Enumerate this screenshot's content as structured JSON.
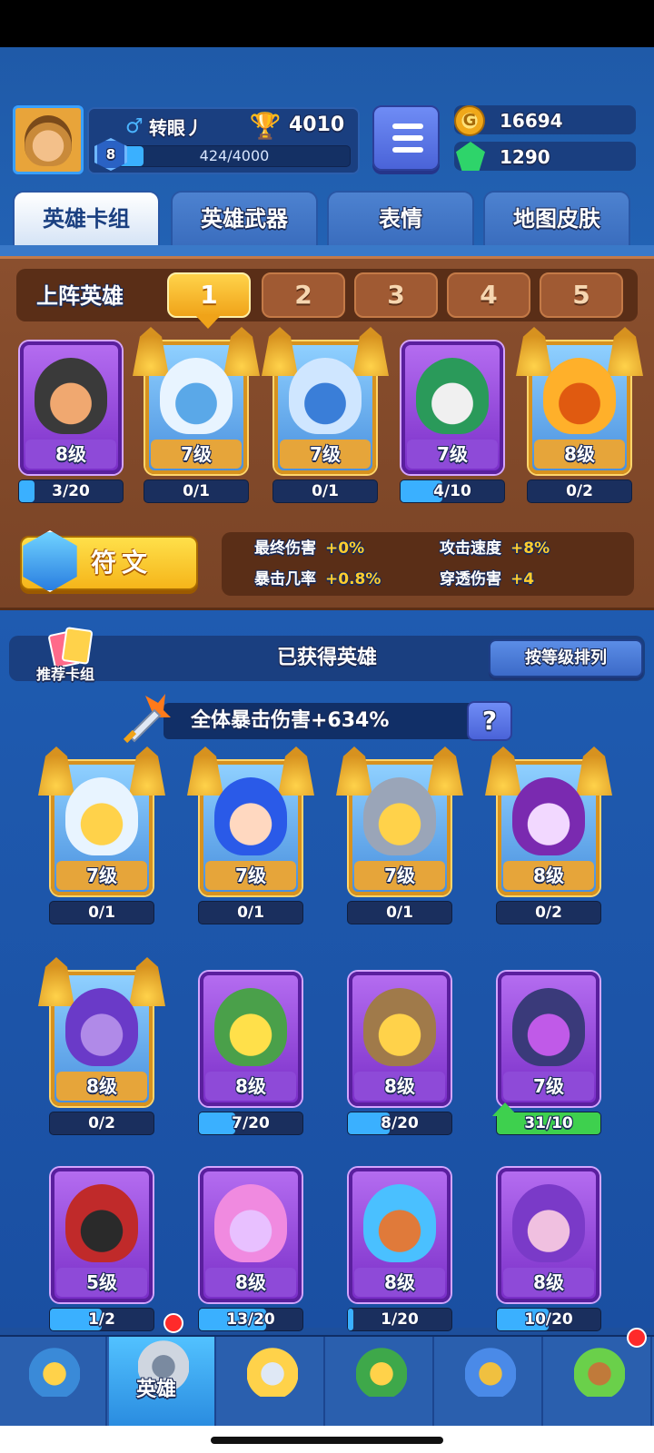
{
  "player": {
    "name": "转眼丿",
    "gender_symbol": "♂",
    "trophies": "4010",
    "level": "8",
    "xp_text": "424/4000",
    "xp_progress": 0.106
  },
  "currency": {
    "gold": "16694",
    "gold_symbol": "G",
    "gems": "1290"
  },
  "tabs": [
    {
      "label": "英雄卡组",
      "active": true
    },
    {
      "label": "英雄武器",
      "active": false
    },
    {
      "label": "表情",
      "active": false
    },
    {
      "label": "地图皮肤",
      "active": false
    }
  ],
  "lineup": {
    "title": "上阵英雄",
    "slots": [
      "1",
      "2",
      "3",
      "4",
      "5"
    ],
    "active_slot": 0,
    "heroes": [
      {
        "level": "8级",
        "progress": "3/20",
        "ratio": 0.15,
        "rarity": "purple",
        "art": "masked-thief"
      },
      {
        "level": "7级",
        "progress": "0/1",
        "ratio": 0.0,
        "rarity": "gold",
        "art": "yeti"
      },
      {
        "level": "7级",
        "progress": "0/1",
        "ratio": 0.0,
        "rarity": "gold",
        "art": "ice-king"
      },
      {
        "level": "7级",
        "progress": "4/10",
        "ratio": 0.4,
        "rarity": "purple",
        "art": "green-hat-ghost"
      },
      {
        "level": "8级",
        "progress": "0/2",
        "ratio": 0.0,
        "rarity": "gold",
        "art": "pumpkin"
      }
    ]
  },
  "rune": {
    "label": "符文",
    "stats": [
      {
        "name": "最终伤害",
        "bonus": "+0%"
      },
      {
        "name": "攻击速度",
        "bonus": "+8%"
      },
      {
        "name": "暴击几率",
        "bonus": "+0.8%"
      },
      {
        "name": "穿透伤害",
        "bonus": "+4"
      }
    ]
  },
  "owned": {
    "deck_label": "推荐卡组",
    "title": "已获得英雄",
    "sort_label": "按等级排列",
    "crit_text": "全体暴击伤害+634%",
    "help_symbol": "?",
    "heroes": [
      {
        "level": "7级",
        "progress": "0/1",
        "ratio": 0.0,
        "rarity": "gold",
        "art": "zeus"
      },
      {
        "level": "7级",
        "progress": "0/1",
        "ratio": 0.0,
        "rarity": "gold",
        "art": "blue-hair-girl"
      },
      {
        "level": "7级",
        "progress": "0/1",
        "ratio": 0.0,
        "rarity": "gold",
        "art": "robot-knight"
      },
      {
        "level": "8级",
        "progress": "0/2",
        "ratio": 0.0,
        "rarity": "gold",
        "art": "skull-reaper"
      },
      {
        "level": "8级",
        "progress": "0/2",
        "ratio": 0.0,
        "rarity": "gold",
        "art": "octopus-pirate"
      },
      {
        "level": "8级",
        "progress": "7/20",
        "ratio": 0.35,
        "rarity": "purple",
        "art": "green-robot"
      },
      {
        "level": "8级",
        "progress": "8/20",
        "ratio": 0.4,
        "rarity": "purple",
        "art": "hooded-mage"
      },
      {
        "level": "7级",
        "progress": "31/10",
        "ratio": 1.0,
        "rarity": "purple",
        "art": "star-hat-officer",
        "upgradable": true
      },
      {
        "level": "5级",
        "progress": "1/2",
        "ratio": 0.5,
        "rarity": "purple",
        "art": "bomb-ninja"
      },
      {
        "level": "8级",
        "progress": "13/20",
        "ratio": 0.65,
        "rarity": "purple",
        "art": "pink-princess"
      },
      {
        "level": "8级",
        "progress": "1/20",
        "ratio": 0.05,
        "rarity": "purple",
        "art": "blue-brute"
      },
      {
        "level": "8级",
        "progress": "10/20",
        "ratio": 0.5,
        "rarity": "purple",
        "art": "top-hat-magician"
      }
    ]
  },
  "nav": {
    "items": [
      {
        "name": "shop",
        "icon": "treasure-chest-icon",
        "label": ""
      },
      {
        "name": "hero",
        "icon": "knight-helmet-icon",
        "label": "英雄",
        "active": true,
        "badge": true
      },
      {
        "name": "battle",
        "icon": "crossed-swords-icon",
        "label": ""
      },
      {
        "name": "rank",
        "icon": "crown-shield-icon",
        "label": ""
      },
      {
        "name": "social",
        "icon": "friends-banner-icon",
        "label": ""
      },
      {
        "name": "garden",
        "icon": "sprout-island-icon",
        "label": "",
        "badge": true
      }
    ]
  },
  "colors": {
    "background": "#1d4f9c",
    "lineup_panel": "#7a4426",
    "accent_gold": "#ffcd2e",
    "purple_card": "#8e4ad8",
    "gold_card": "#e6a53a",
    "progress_blue": "#3ab0ff",
    "progress_green": "#3ed04e"
  }
}
